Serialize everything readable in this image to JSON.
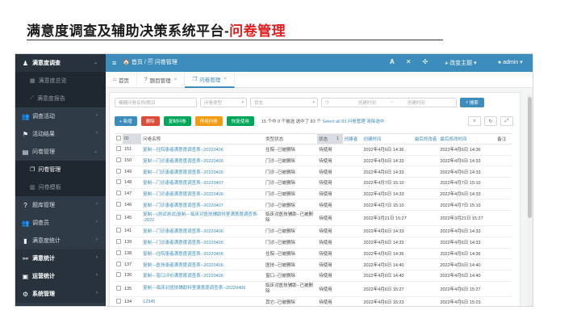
{
  "slide": {
    "title_main": "满意度调查及辅助决策系统平台-",
    "title_accent": "问卷管理"
  },
  "sidebar": {
    "items": [
      {
        "label": "满意度调查",
        "icon": "person-icon",
        "type": "top"
      },
      {
        "label": "满意度总览",
        "icon": "chart-icon",
        "type": "sub"
      },
      {
        "label": "满意度报告",
        "icon": "chart-line-icon",
        "type": "sub"
      },
      {
        "label": "调查活动",
        "icon": "users-icon",
        "type": "item"
      },
      {
        "label": "活动结果",
        "icon": "flag-icon",
        "type": "item"
      },
      {
        "label": "问卷管理",
        "icon": "doc-icon",
        "type": "item"
      },
      {
        "label": "问卷管理",
        "icon": "copy-icon",
        "type": "sub-active"
      },
      {
        "label": "问卷模板",
        "icon": "template-icon",
        "type": "sub"
      },
      {
        "label": "题库管理",
        "icon": "question-icon",
        "type": "item"
      },
      {
        "label": "调查员",
        "icon": "users-icon",
        "type": "item"
      },
      {
        "label": "满意度统计",
        "icon": "bar-icon",
        "type": "item"
      },
      {
        "label": "满意统计",
        "icon": "network-icon",
        "type": "top2"
      },
      {
        "label": "运营统计",
        "icon": "stats-icon",
        "type": "top2"
      },
      {
        "label": "系统管理",
        "icon": "gear-icon",
        "type": "top2"
      }
    ]
  },
  "topbar": {
    "breadcrumb": "🏠 首页 / 🗐 问卷管理",
    "theme_label": "改变主题",
    "admin_label": "admin"
  },
  "tabs": [
    {
      "label": "首页",
      "icon": "home-icon"
    },
    {
      "label": "题目管理",
      "icon": "question-icon"
    },
    {
      "label": "问卷管理",
      "icon": "copy-icon",
      "active": true
    }
  ],
  "search": {
    "name_placeholder": "模糊问卷名称/题目",
    "type_placeholder": "问卷类型",
    "status_placeholder": "状态",
    "start_placeholder": "创建时间",
    "end_placeholder": "创建时间",
    "search_label": "搜索"
  },
  "actions": {
    "add": "+ 新增",
    "delete": "删除",
    "copy": "复制问卷",
    "disable": "停用问卷",
    "enable": "恢复使用",
    "info_text": "15 个中 0 个被选  选中了 83 个",
    "select_all": "Select all 83 问卷管理",
    "clear": "清除选中",
    "colors": {
      "add": "#3c8dbc",
      "delete": "#dd4b39",
      "copy": "#00a65a",
      "disable": "#f39c12",
      "enable": "#00a65a"
    }
  },
  "table": {
    "headers": [
      "ID",
      "问卷名称",
      "类型状态",
      "状态",
      "1",
      "创建者",
      "创建时间",
      "最后修改者",
      "最后修改时间",
      "备注"
    ],
    "rows": [
      {
        "id": "151",
        "name": "复制---住院患者满意度调查表--20220406",
        "type": "住院--已被删除",
        "status": "待使用",
        "created": "2022年4月6日 14:36",
        "modified": "2022年4月6日 14:36"
      },
      {
        "id": "150",
        "name": "复制---门诊患者满意度调查表--20220406",
        "type": "门诊--已被删除",
        "status": "待使用",
        "created": "2022年4月6日 14:33",
        "modified": "2022年4月6日 14:33"
      },
      {
        "id": "149",
        "name": "复制---门诊患者满意度调查表--20220406",
        "type": "门诊--已被删除",
        "status": "待使用",
        "created": "2022年4月6日 14:33",
        "modified": "2022年4月6日 14:33"
      },
      {
        "id": "148",
        "name": "复制---门诊患者满意度调查表--20220407",
        "type": "门诊--已被删除",
        "status": "待使用",
        "created": "2022年4月7日 15:10",
        "modified": "2022年4月7日 15:10"
      },
      {
        "id": "147",
        "name": "复制---门诊患者满意度调查表--20220406",
        "type": "门诊--已被删除",
        "status": "待使用",
        "created": "2022年4月6日 14:33",
        "modified": "2022年4月6日 14:33"
      },
      {
        "id": "146",
        "name": "复制---门诊患者满意度调查表--20220407",
        "type": "门诊--已被删除",
        "status": "待使用",
        "created": "2022年4月7日 15:10",
        "modified": "2022年4月7日 15:10"
      },
      {
        "id": "145",
        "name": "复制---(测试测试)复制---临床对医技辅助科室满意度调查表--2022",
        "type": "临床对医技辅助--已被删除",
        "status": "待使用",
        "created": "2022年3月21日 15:27",
        "modified": "2022年3月21日 15:27",
        "tall": true
      },
      {
        "id": "141",
        "name": "复制---门诊患者满意度调查表--20220406",
        "type": "门诊--已被删除",
        "status": "待使用",
        "created": "2022年4月6日 14:33",
        "modified": "2022年4月6日 14:33"
      },
      {
        "id": "139",
        "name": "复制---门诊患者满意度调查表--20220406",
        "type": "门诊--已被删除",
        "status": "待使用",
        "created": "2022年4月6日 14:33",
        "modified": "2022年4月6日 14:33"
      },
      {
        "id": "138",
        "name": "复制---住院患者满意度调查表--20220406",
        "type": "住院--已被删除",
        "status": "待使用",
        "created": "2022年4月6日 14:36",
        "modified": "2022年4月6日 14:36"
      },
      {
        "id": "137",
        "name": "复制---医技患者满意度调查表--20220406",
        "type": "医技--已被删除",
        "status": "待使用",
        "created": "2022年4月6日 14:40",
        "modified": "2022年4月6日 14:40"
      },
      {
        "id": "136",
        "name": "复制---窗口评价满意度调查表--20220406",
        "type": "窗口--已被删除",
        "status": "待使用",
        "created": "2022年4月6日 14:40",
        "modified": "2022年4月6日 14:40"
      },
      {
        "id": "135",
        "name": "复制---临床对医技辅助科室满意度调查表--20220406",
        "type": "临床对医技辅助--已被删除",
        "status": "待使用",
        "created": "2022年4月6日 15:27",
        "modified": "2022年4月6日 15:27",
        "tall": true
      },
      {
        "id": "134",
        "name": "12345",
        "type": "其它--已被删除",
        "status": "待使用",
        "created": "2022年4月6日 15:23",
        "modified": "2022年4月6日 15:23"
      }
    ]
  }
}
